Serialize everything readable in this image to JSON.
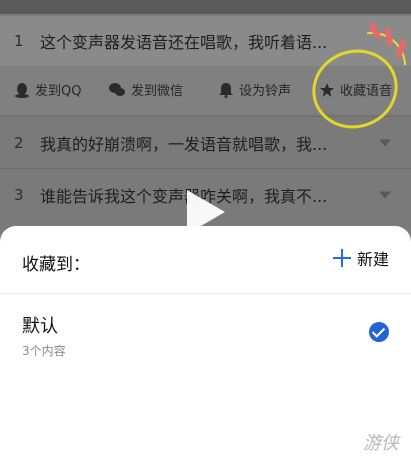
{
  "list": {
    "items": [
      {
        "num": "1",
        "text": "这个变声器发语音还在唱歌，我听着语..."
      },
      {
        "num": "2",
        "text": "我真的好崩溃啊，一发语音就唱歌，我..."
      },
      {
        "num": "3",
        "text": "谁能告诉我这个变声器咋关啊，我真不..."
      }
    ]
  },
  "actions": {
    "send_qq": "发到QQ",
    "send_wechat": "发到微信",
    "ringtone": "设为铃声",
    "favorite": "收藏语音"
  },
  "sheet": {
    "title": "收藏到：",
    "new_label": "新建",
    "folder_name": "默认",
    "folder_count": "3个内容"
  },
  "watermark": "游侠",
  "colors": {
    "accent": "#2463d6",
    "highlight_circle": "#e3d82a"
  }
}
